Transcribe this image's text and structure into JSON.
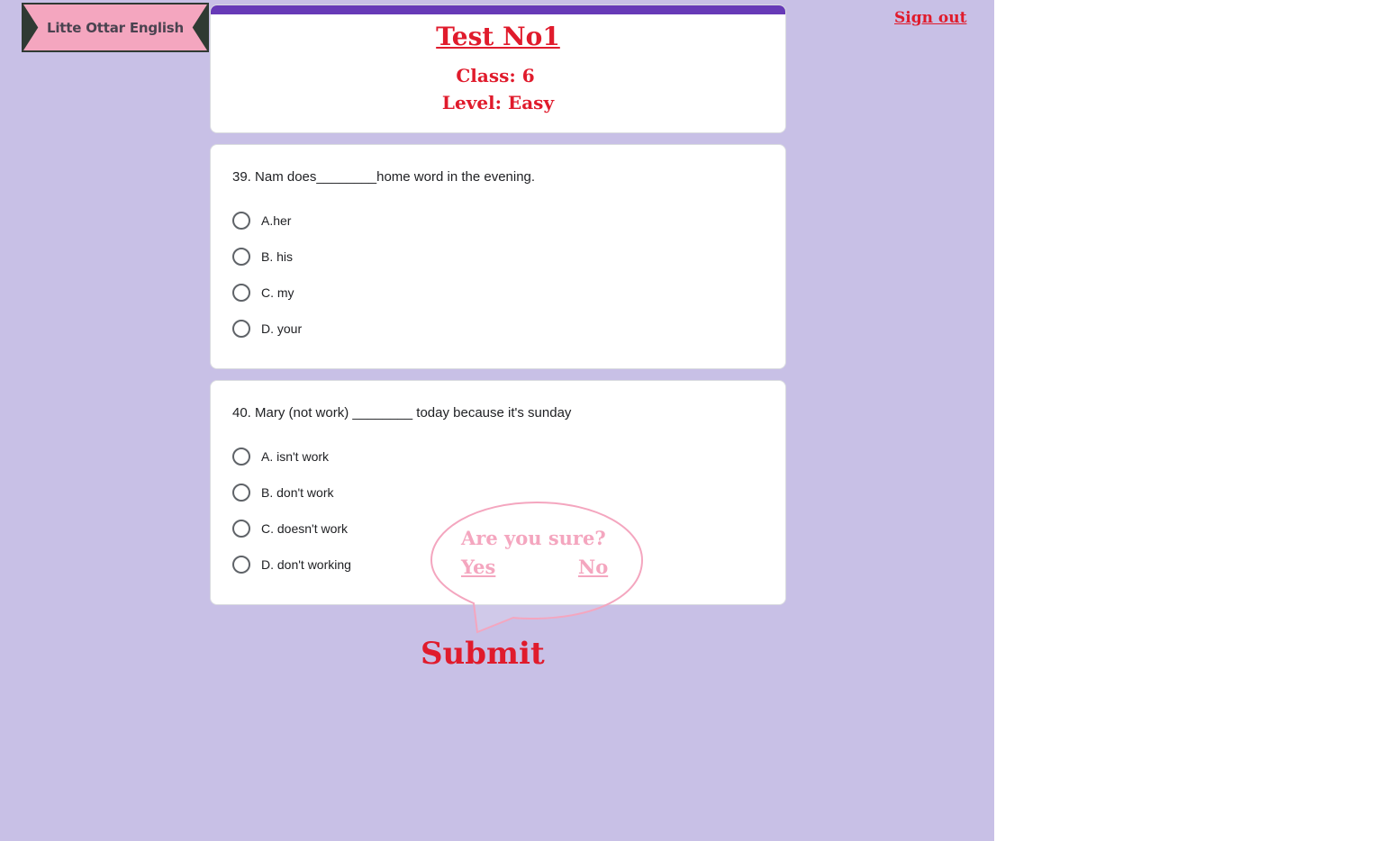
{
  "logo": {
    "text": "Litte Ottar English"
  },
  "header": {
    "title": "Test No1",
    "class_line": "Class: 6",
    "level_line": "Level: Easy"
  },
  "nav": {
    "sign_out": "Sign out"
  },
  "questions": [
    {
      "text": "39. Nam does________home word in the evening.",
      "options": [
        "A.her",
        "B. his",
        "C. my",
        "D. your"
      ]
    },
    {
      "text": "40. Mary (not work) ________ today because it's sunday",
      "options": [
        "A. isn't work",
        "B. don't work",
        "C. doesn't work",
        "D. don't working"
      ]
    }
  ],
  "confirm": {
    "question": "Are you sure?",
    "yes": "Yes ",
    "no": " No"
  },
  "submit_label": "Submit",
  "colors": {
    "background": "#c8c0e6",
    "accent_red": "#e01b2c",
    "header_bar": "#673ab7",
    "bubble_pink": "#f4a6bf"
  }
}
